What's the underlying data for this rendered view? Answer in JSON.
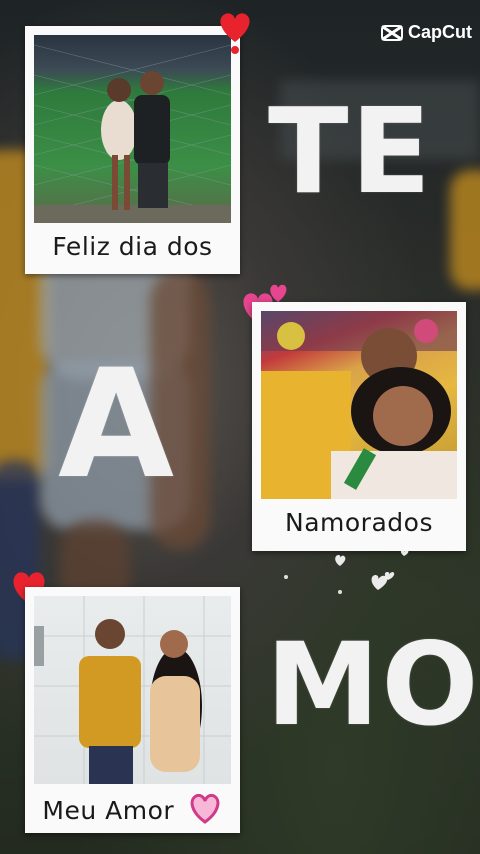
{
  "app": {
    "logo_text": "CapCut",
    "logo_icon": "capcut-logo-icon"
  },
  "captions": {
    "photo1": "Feliz dia dos",
    "photo2": "Namorados",
    "photo3": "Meu Amor"
  },
  "big_text": {
    "line1": "TE",
    "line2": "A",
    "line3": "MO"
  },
  "colors": {
    "heart_red": "#e8232e",
    "heart_pink": "#e7458f",
    "polaroid": "#fafafa",
    "letters": "#f2f2f2"
  },
  "icons": [
    "red-heart-icon",
    "pink-hearts-icon",
    "pink-outline-heart-icon",
    "white-hearts-icon"
  ]
}
